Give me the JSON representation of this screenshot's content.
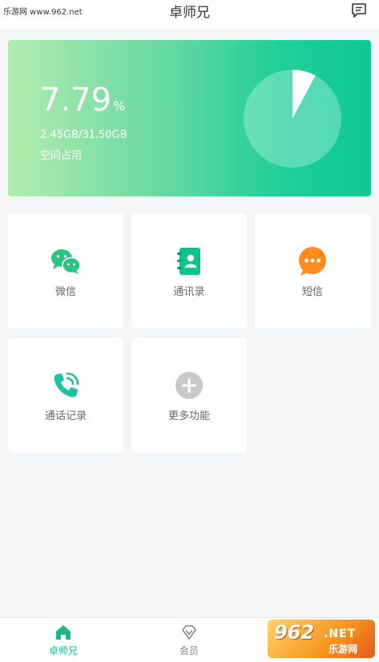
{
  "watermark_top": "乐游网 www.962.net",
  "header": {
    "title": "卓师兄"
  },
  "storage": {
    "percent": "7.79",
    "percent_unit": "%",
    "used_fraction": 0.0779,
    "usage_text": "2.45GB/31.50GB",
    "usage_label": "空间占用"
  },
  "tiles": [
    {
      "label": "微信",
      "icon": "wechat-icon"
    },
    {
      "label": "通讯录",
      "icon": "contacts-icon"
    },
    {
      "label": "短信",
      "icon": "sms-icon"
    },
    {
      "label": "通话记录",
      "icon": "phone-icon"
    },
    {
      "label": "更多功能",
      "icon": "plus-icon"
    }
  ],
  "nav": [
    {
      "label": "卓师兄",
      "icon": "home-icon",
      "active": true
    },
    {
      "label": "会员",
      "icon": "diamond-icon",
      "active": false
    }
  ],
  "watermark_badge": {
    "line1": "962",
    "line2": ".NET",
    "line3": "乐游网"
  },
  "colors": {
    "accent": "#1cb88a",
    "wechat": "#2dc482",
    "contacts": "#0ec48a",
    "sms": "#ff8a1f",
    "phone": "#1bc3a3",
    "plus": "#c9c9cc"
  }
}
